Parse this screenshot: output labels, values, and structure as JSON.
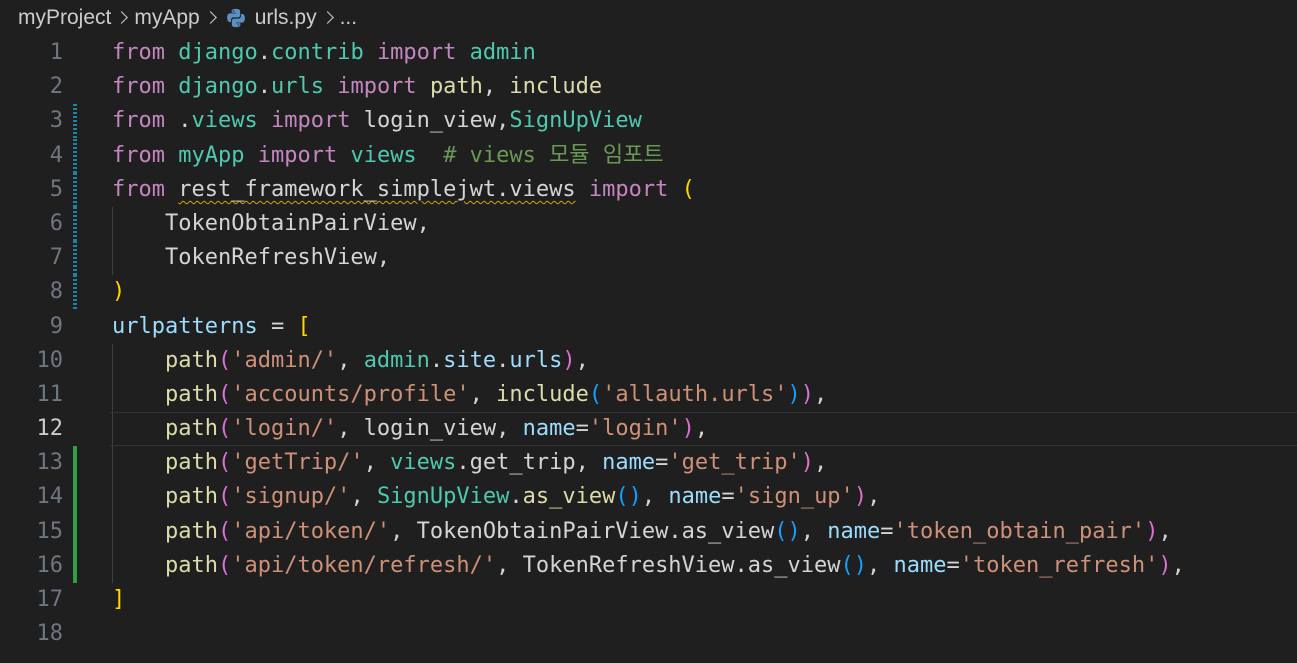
{
  "breadcrumb": {
    "project": "myProject",
    "app": "myApp",
    "file": "urls.py",
    "more": "..."
  },
  "colors": {
    "background": "#1f1f1f",
    "keyword": "#c586c0",
    "module": "#4ec9b0",
    "function": "#dcdcaa",
    "variable": "#9cdcfe",
    "string": "#ce9178",
    "comment": "#6a9955",
    "bracket_1": "#ffd700",
    "bracket_2": "#da70d6",
    "bracket_3": "#179fff",
    "gutter_added": "#2ea043",
    "gutter_modified": "#1b81a8"
  },
  "editor": {
    "active_line": 12,
    "lines": [
      {
        "n": "1",
        "gutter": "",
        "indent": 0,
        "tokens": [
          [
            "from",
            "kw"
          ],
          [
            " ",
            ""
          ],
          [
            "django",
            "mod"
          ],
          [
            ".",
            ""
          ],
          [
            "contrib",
            "mod"
          ],
          [
            " ",
            ""
          ],
          [
            "import",
            "kw"
          ],
          [
            " ",
            ""
          ],
          [
            "admin",
            "mod"
          ]
        ]
      },
      {
        "n": "2",
        "gutter": "",
        "indent": 0,
        "tokens": [
          [
            "from",
            "kw"
          ],
          [
            " ",
            ""
          ],
          [
            "django",
            "mod"
          ],
          [
            ".",
            ""
          ],
          [
            "urls",
            "mod"
          ],
          [
            " ",
            ""
          ],
          [
            "import",
            "kw"
          ],
          [
            " ",
            ""
          ],
          [
            "path",
            "fn"
          ],
          [
            ", ",
            ""
          ],
          [
            "include",
            "fn"
          ]
        ]
      },
      {
        "n": "3",
        "gutter": "mod",
        "indent": 0,
        "tokens": [
          [
            "from",
            "kw"
          ],
          [
            " .",
            ""
          ],
          [
            "views",
            "mod"
          ],
          [
            " ",
            ""
          ],
          [
            "import",
            "kw"
          ],
          [
            " login_view,",
            ""
          ],
          [
            "SignUpView",
            "cls"
          ]
        ]
      },
      {
        "n": "4",
        "gutter": "mod",
        "indent": 0,
        "tokens": [
          [
            "from",
            "kw"
          ],
          [
            " ",
            ""
          ],
          [
            "myApp",
            "mod"
          ],
          [
            " ",
            ""
          ],
          [
            "import",
            "kw"
          ],
          [
            " ",
            ""
          ],
          [
            "views",
            "mod"
          ],
          [
            "  ",
            ""
          ],
          [
            "# views 모듈 임포트",
            "cm"
          ]
        ]
      },
      {
        "n": "5",
        "gutter": "mod",
        "indent": 0,
        "tokens": [
          [
            "from",
            "kw"
          ],
          [
            " ",
            ""
          ],
          [
            "rest_framework_simplejwt.views",
            "squig"
          ],
          [
            " ",
            ""
          ],
          [
            "import",
            "kw"
          ],
          [
            " ",
            ""
          ],
          [
            "(",
            "b1"
          ]
        ]
      },
      {
        "n": "6",
        "gutter": "mod",
        "indent": 1,
        "tokens": [
          [
            "    TokenObtainPairView,",
            ""
          ]
        ]
      },
      {
        "n": "7",
        "gutter": "mod",
        "indent": 1,
        "tokens": [
          [
            "    TokenRefreshView,",
            ""
          ]
        ]
      },
      {
        "n": "8",
        "gutter": "mod",
        "indent": 0,
        "tokens": [
          [
            ")",
            "b1"
          ]
        ]
      },
      {
        "n": "9",
        "gutter": "",
        "indent": 0,
        "tokens": [
          [
            "urlpatterns",
            "var"
          ],
          [
            " = ",
            ""
          ],
          [
            "[",
            "b1"
          ]
        ]
      },
      {
        "n": "10",
        "gutter": "",
        "indent": 1,
        "tokens": [
          [
            "    ",
            ""
          ],
          [
            "path",
            "fn"
          ],
          [
            "(",
            "b2"
          ],
          [
            "'admin/'",
            "str"
          ],
          [
            ", ",
            ""
          ],
          [
            "admin",
            "mod"
          ],
          [
            ".",
            ""
          ],
          [
            "site",
            "var"
          ],
          [
            ".",
            ""
          ],
          [
            "urls",
            "var"
          ],
          [
            ")",
            "b2"
          ],
          [
            ",",
            ""
          ]
        ]
      },
      {
        "n": "11",
        "gutter": "",
        "indent": 1,
        "tokens": [
          [
            "    ",
            ""
          ],
          [
            "path",
            "fn"
          ],
          [
            "(",
            "b2"
          ],
          [
            "'accounts/profile'",
            "str"
          ],
          [
            ", ",
            ""
          ],
          [
            "include",
            "fn"
          ],
          [
            "(",
            "b3"
          ],
          [
            "'allauth.urls'",
            "str"
          ],
          [
            ")",
            "b3"
          ],
          [
            ")",
            "b2"
          ],
          [
            ",",
            ""
          ]
        ]
      },
      {
        "n": "12",
        "gutter": "",
        "indent": 1,
        "tokens": [
          [
            "    ",
            ""
          ],
          [
            "path",
            "fn"
          ],
          [
            "(",
            "b2"
          ],
          [
            "'login/'",
            "str"
          ],
          [
            ", login_view, ",
            ""
          ],
          [
            "name",
            "var"
          ],
          [
            "=",
            ""
          ],
          [
            "'login'",
            "str"
          ],
          [
            ")",
            "b2"
          ],
          [
            ",",
            ""
          ]
        ]
      },
      {
        "n": "13",
        "gutter": "add",
        "indent": 1,
        "tokens": [
          [
            "    ",
            ""
          ],
          [
            "path",
            "fn"
          ],
          [
            "(",
            "b2"
          ],
          [
            "'getTrip/'",
            "str"
          ],
          [
            ", ",
            ""
          ],
          [
            "views",
            "mod"
          ],
          [
            ".get_trip, ",
            ""
          ],
          [
            "name",
            "var"
          ],
          [
            "=",
            ""
          ],
          [
            "'get_trip'",
            "str"
          ],
          [
            ")",
            "b2"
          ],
          [
            ",",
            ""
          ]
        ]
      },
      {
        "n": "14",
        "gutter": "add",
        "indent": 1,
        "tokens": [
          [
            "    ",
            ""
          ],
          [
            "path",
            "fn"
          ],
          [
            "(",
            "b2"
          ],
          [
            "'signup/'",
            "str"
          ],
          [
            ", ",
            ""
          ],
          [
            "SignUpView",
            "cls"
          ],
          [
            ".",
            ""
          ],
          [
            "as_view",
            "fn"
          ],
          [
            "(",
            "b3"
          ],
          [
            ")",
            "b3"
          ],
          [
            ", ",
            ""
          ],
          [
            "name",
            "var"
          ],
          [
            "=",
            ""
          ],
          [
            "'sign_up'",
            "str"
          ],
          [
            ")",
            "b2"
          ],
          [
            ",",
            ""
          ]
        ]
      },
      {
        "n": "15",
        "gutter": "add",
        "indent": 1,
        "tokens": [
          [
            "    ",
            ""
          ],
          [
            "path",
            "fn"
          ],
          [
            "(",
            "b2"
          ],
          [
            "'api/token/'",
            "str"
          ],
          [
            ", TokenObtainPairView.as_view",
            ""
          ],
          [
            "(",
            "b3"
          ],
          [
            ")",
            "b3"
          ],
          [
            ", ",
            ""
          ],
          [
            "name",
            "var"
          ],
          [
            "=",
            ""
          ],
          [
            "'token_obtain_pair'",
            "str"
          ],
          [
            ")",
            "b2"
          ],
          [
            ",",
            ""
          ]
        ]
      },
      {
        "n": "16",
        "gutter": "add",
        "indent": 1,
        "tokens": [
          [
            "    ",
            ""
          ],
          [
            "path",
            "fn"
          ],
          [
            "(",
            "b2"
          ],
          [
            "'api/token/refresh/'",
            "str"
          ],
          [
            ", TokenRefreshView.as_view",
            ""
          ],
          [
            "(",
            "b3"
          ],
          [
            ")",
            "b3"
          ],
          [
            ", ",
            ""
          ],
          [
            "name",
            "var"
          ],
          [
            "=",
            ""
          ],
          [
            "'token_refresh'",
            "str"
          ],
          [
            ")",
            "b2"
          ],
          [
            ",",
            ""
          ]
        ]
      },
      {
        "n": "17",
        "gutter": "",
        "indent": 0,
        "tokens": [
          [
            "]",
            "b1"
          ]
        ]
      },
      {
        "n": "18",
        "gutter": "",
        "indent": 0,
        "tokens": []
      }
    ]
  }
}
